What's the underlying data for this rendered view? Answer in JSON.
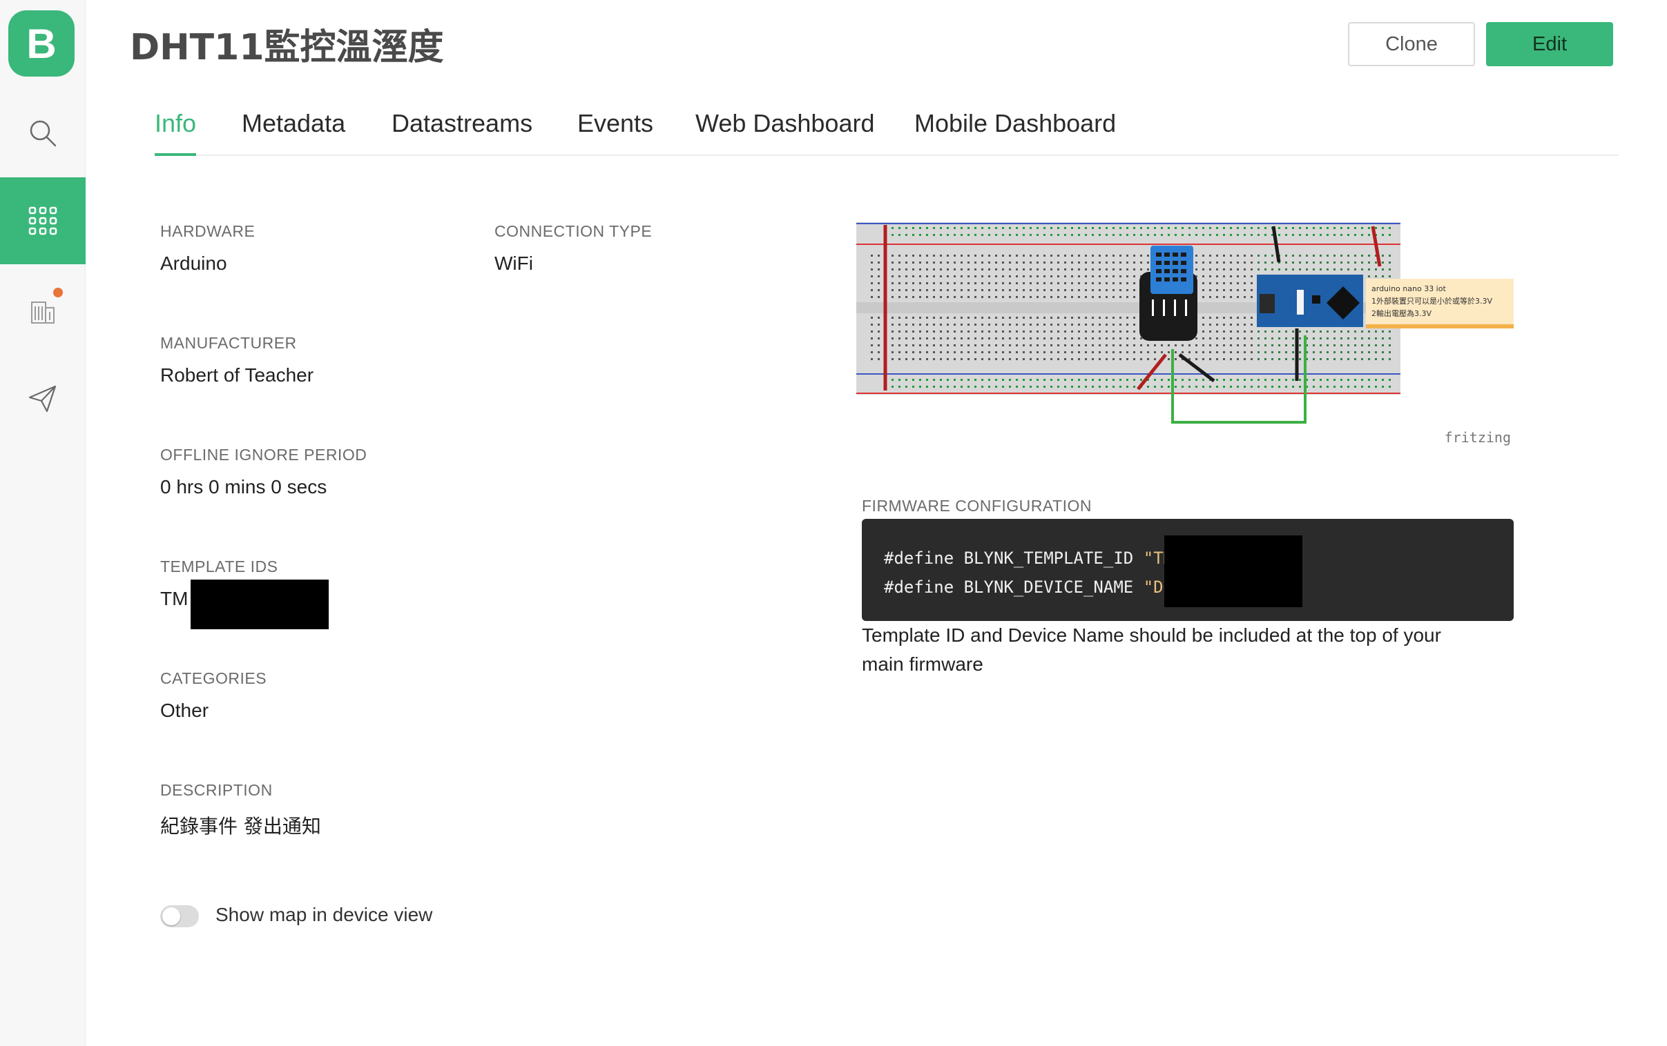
{
  "app": {
    "logo_letter": "B",
    "accent_color": "#3ab77a",
    "title": "DHT11監控溫溼度"
  },
  "sidebar": {
    "items": [
      {
        "icon": "search-icon",
        "active": false
      },
      {
        "icon": "grid-icon",
        "active": true
      },
      {
        "icon": "building-icon",
        "active": false,
        "badge_color": "#e8743b"
      },
      {
        "icon": "send-icon",
        "active": false
      }
    ]
  },
  "header": {
    "clone_label": "Clone",
    "edit_label": "Edit"
  },
  "tabs": [
    {
      "label": "Info",
      "active": true
    },
    {
      "label": "Metadata",
      "active": false
    },
    {
      "label": "Datastreams",
      "active": false
    },
    {
      "label": "Events",
      "active": false
    },
    {
      "label": "Web Dashboard",
      "active": false
    },
    {
      "label": "Mobile Dashboard",
      "active": false
    }
  ],
  "info": {
    "hardware_label": "HARDWARE",
    "hardware_value": "Arduino",
    "connection_label": "CONNECTION TYPE",
    "connection_value": "WiFi",
    "manufacturer_label": "MANUFACTURER",
    "manufacturer_value": "Robert of Teacher",
    "offline_label": "OFFLINE IGNORE PERIOD",
    "offline_value": "0 hrs 0 mins 0 secs",
    "template_ids_label": "TEMPLATE IDS",
    "template_ids_value": "TM",
    "categories_label": "CATEGORIES",
    "categories_value": "Other",
    "description_label": "DESCRIPTION",
    "description_value": "紀錄事件 發出通知",
    "show_map_label": "Show map in device view",
    "show_map_enabled": false
  },
  "diagram": {
    "note_line1": "arduino nano 33 iot",
    "note_line2": "1外部裝置只可以是小於或等於3.3V",
    "note_line3": "2輸出電壓為3.3V",
    "watermark": "fritzing"
  },
  "firmware": {
    "label": "FIRMWARE CONFIGURATION",
    "line1_code": "#define BLYNK_TEMPLATE_ID ",
    "line1_str": "\"TM",
    "line2_code": "#define BLYNK_DEVICE_NAME ",
    "line2_str": "\"DH",
    "help_text": "Template ID and Device Name should be included at the top of your main firmware"
  }
}
